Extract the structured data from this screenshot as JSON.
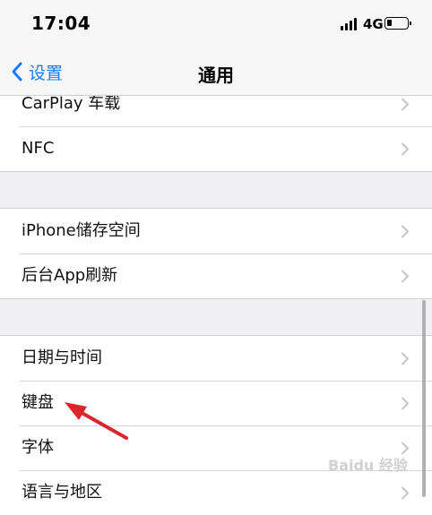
{
  "status_bar": {
    "time": "17:04",
    "network": "4G"
  },
  "nav": {
    "back_label": "设置",
    "title": "通用"
  },
  "group1": {
    "items": [
      {
        "label": "CarPlay 车载"
      },
      {
        "label": "NFC"
      }
    ]
  },
  "group2": {
    "items": [
      {
        "label": "iPhone储存空间"
      },
      {
        "label": "后台App刷新"
      }
    ]
  },
  "group3": {
    "items": [
      {
        "label": "日期与时间"
      },
      {
        "label": "键盘"
      },
      {
        "label": "字体"
      },
      {
        "label": "语言与地区"
      }
    ]
  },
  "watermark": "Baidu 经验",
  "colors": {
    "accent": "#1a7cf5",
    "annotation_arrow": "#d9262b",
    "background": "#efeff4"
  }
}
